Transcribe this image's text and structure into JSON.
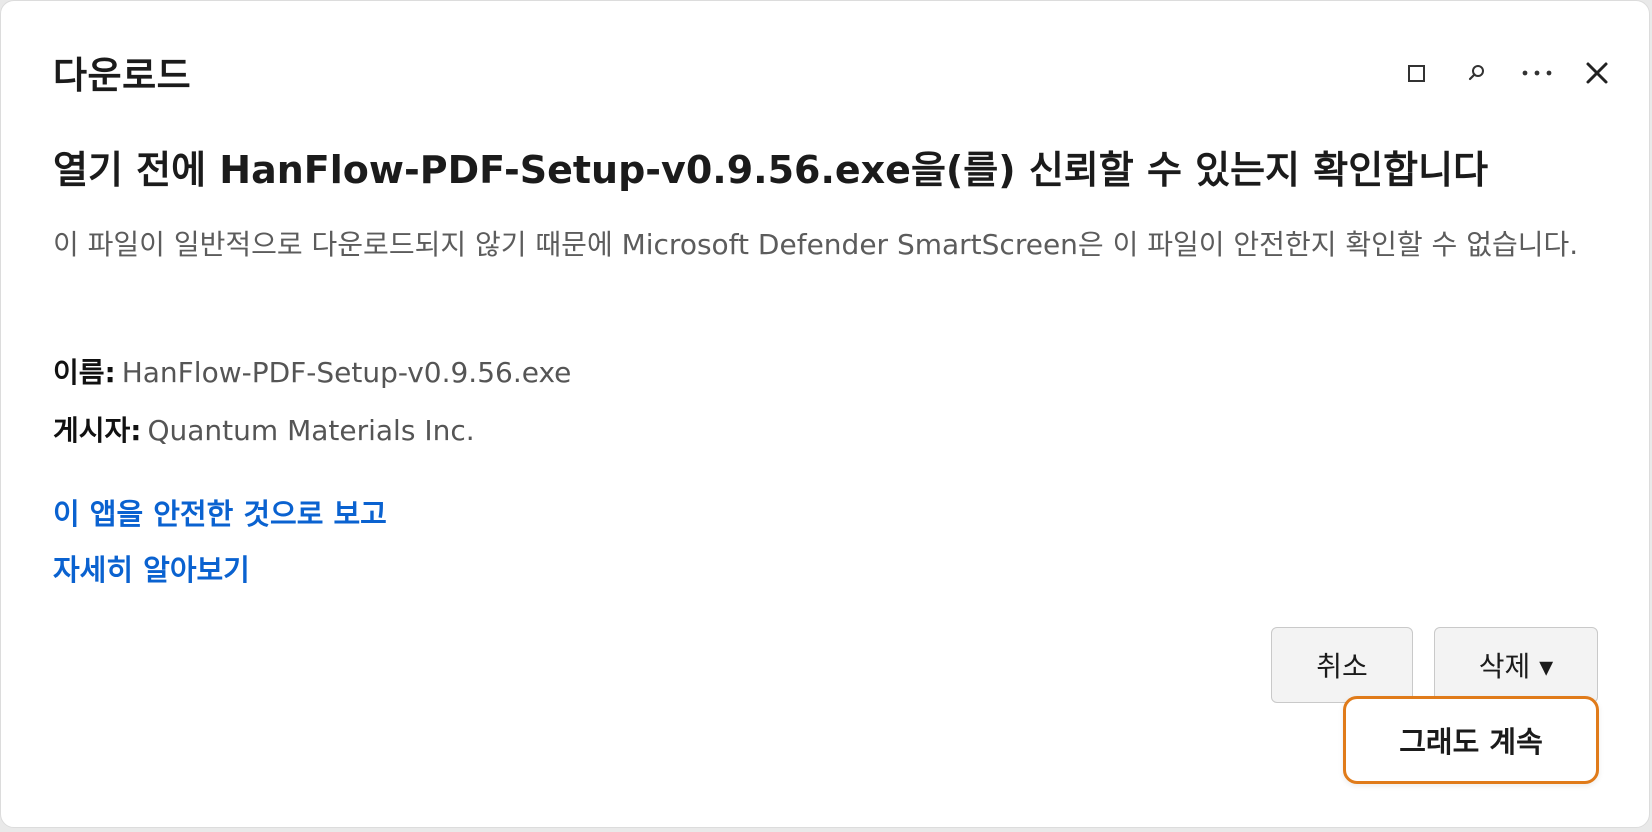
{
  "header": {
    "title": "다운로드",
    "icons": [
      "maximize-icon",
      "search-icon",
      "more-icon",
      "close-icon"
    ]
  },
  "main": {
    "headline": "열기 전에 HanFlow-PDF-Setup-v0.9.56.exe을(를) 신뢰할 수 있는지 확인합니다",
    "description": "이 파일이 일반적으로 다운로드되지 않기 때문에 Microsoft Defender SmartScreen은 이 파일이 안전한지 확인할 수 없습니다.",
    "name_label": "이름:",
    "name_value": "HanFlow-PDF-Setup-v0.9.56.exe",
    "publisher_label": "게시자:",
    "publisher_value": "Quantum Materials Inc.",
    "report_link": "이 앱을 안전한 것으로 보고",
    "learn_link": "자세히 알아보기"
  },
  "buttons": {
    "cancel": "취소",
    "delete": "삭제 ▾",
    "continue_anyway": "그래도 계속"
  },
  "colors": {
    "link": "#0a62d0",
    "highlight_border": "#e07b1a"
  }
}
